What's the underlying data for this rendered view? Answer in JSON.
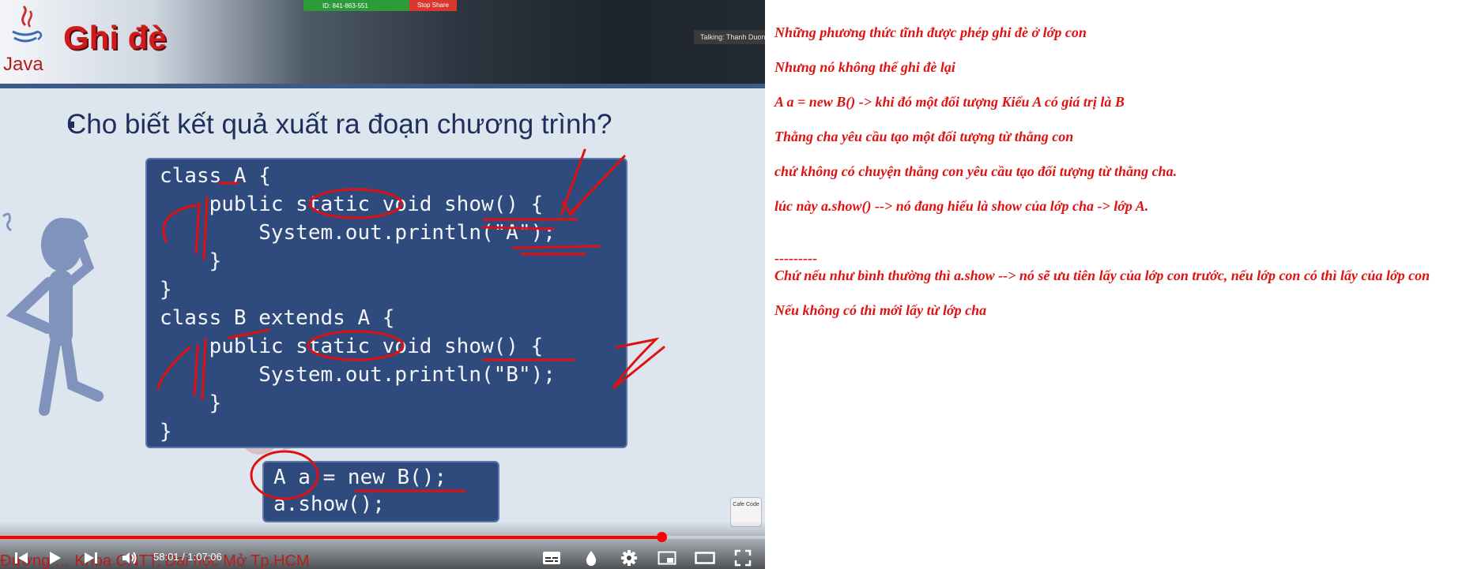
{
  "player": {
    "slide": {
      "logo_text": "Java",
      "title": "Ghi đè",
      "question": "Cho biết kết quả xuất ra đoạn chương trình?",
      "code_main": [
        "class A {",
        "    public static void show() {",
        "        System.out.println(\"A\");",
        "    }",
        "}",
        "class B extends A {",
        "    public static void show() {",
        "        System.out.println(\"B\");",
        "    }",
        "}"
      ],
      "code_call": [
        "A a = new B();",
        "a.show();"
      ],
      "watermark": "CÂU HỎI",
      "logo_badge": "Cafe Code",
      "footer": "Đường … Khoa CNTT, Đại học Mở Tp.HCM"
    },
    "meeting": {
      "id": "ID: 841-863-551",
      "stop_share": "Stop Share",
      "talking": "Talking: Thanh Duong"
    },
    "controls": {
      "time_current": "58:01",
      "time_separator": " / ",
      "time_total": "1:07:06",
      "progress_fraction": 0.865
    },
    "colors": {
      "progress": "#ff0000",
      "annotation": "#e01010"
    }
  },
  "notes": [
    "Những phương thức tĩnh được phép ghi đè ở lớp con",
    "Nhưng nó không thể ghi đè lại",
    "A a = new B() -> khi đó một đối tượng Kiểu A có giá trị là B",
    "Thằng cha yêu cầu tạo một đối tượng từ thằng con",
    "chứ không có chuyện thằng con yêu cầu tạo đối tượng từ thằng cha.",
    "lúc này a.show() --> nó đang hiểu là show của lớp cha -> lớp A.",
    "---------",
    "Chứ nếu như bình thường thì a.show --> nó sẽ ưu tiên lấy của lớp con trước, nếu lớp con có thì lấy của lớp con",
    "Nếu không có thì mới lấy từ lớp cha"
  ]
}
